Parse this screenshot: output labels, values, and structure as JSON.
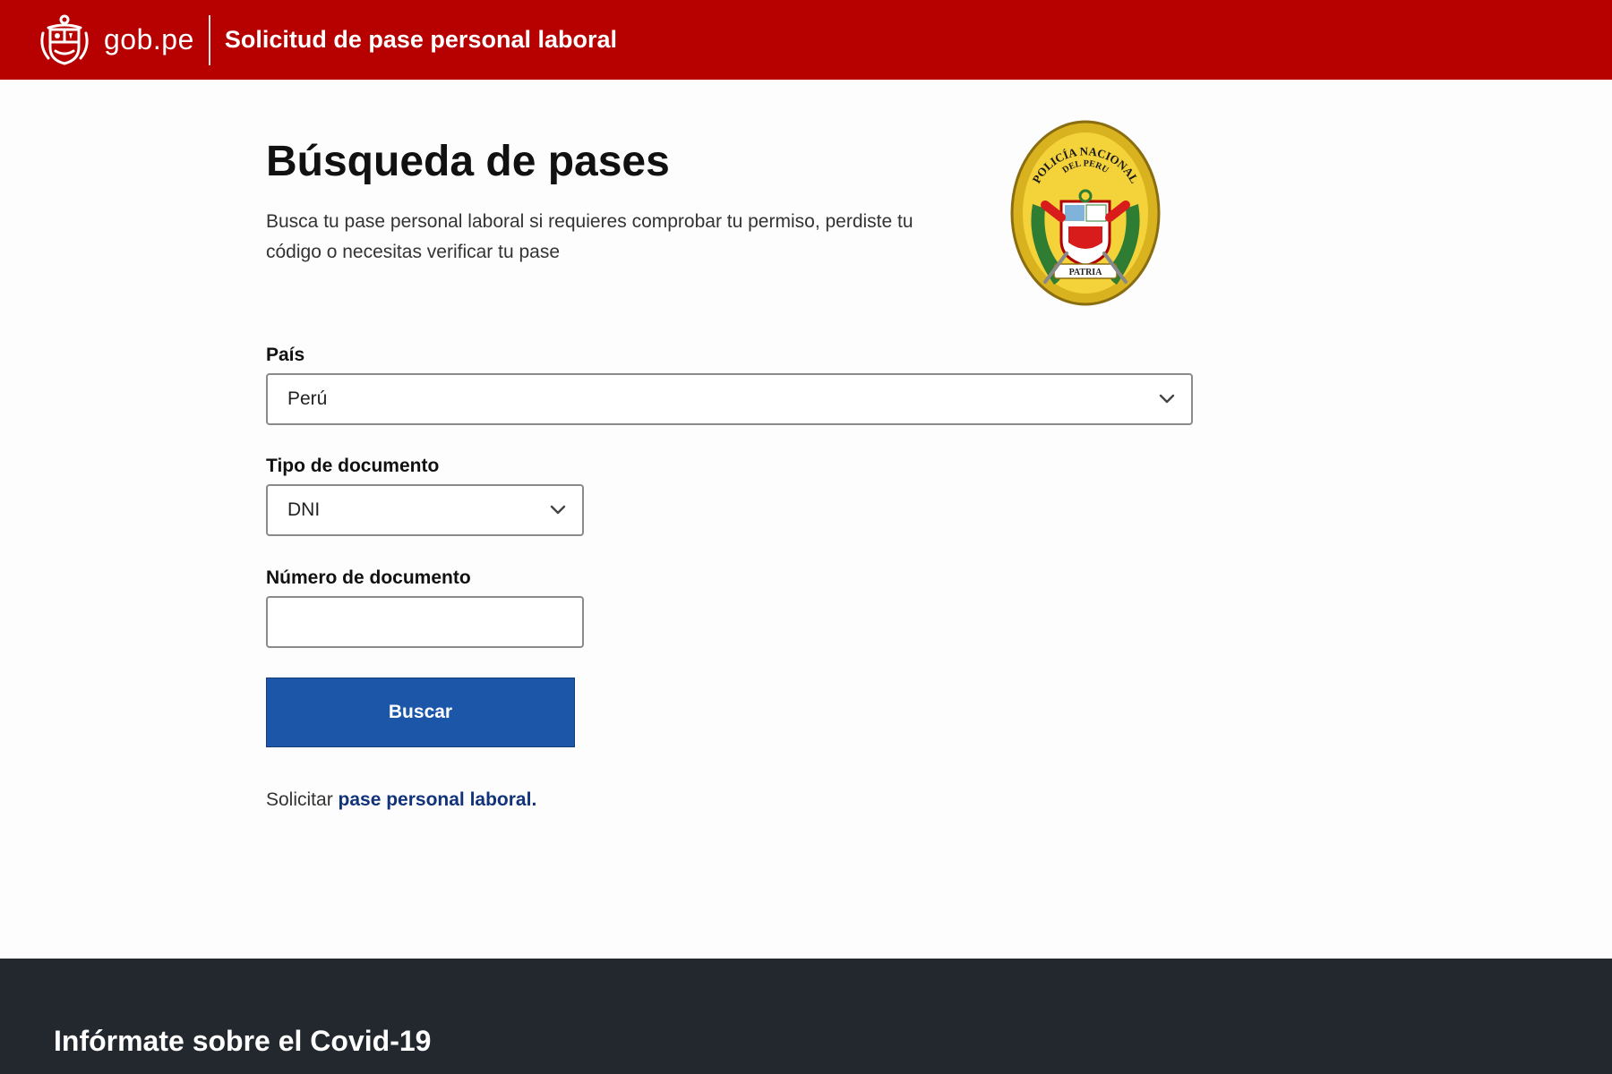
{
  "header": {
    "brand_text": "gob.pe",
    "title": "Solicitud de pase personal laboral",
    "brand_color": "#b70000"
  },
  "main": {
    "title": "Búsqueda de pases",
    "description": "Busca tu pase personal laboral si requieres comprobar tu permiso, perdiste tu código o necesitas verificar tu pase",
    "badge": {
      "text_top": "POLICÍA NACIONAL",
      "text_mid": "DEL PERU",
      "text_bottom": "PATRIA"
    },
    "country": {
      "label": "País",
      "value": "Perú"
    },
    "doc_type": {
      "label": "Tipo de documento",
      "value": "DNI"
    },
    "doc_number": {
      "label": "Número de documento",
      "value": ""
    },
    "search_button": "Buscar",
    "request_prefix": "Solicitar ",
    "request_link": "pase personal laboral."
  },
  "footer": {
    "title": "Infórmate sobre el Covid-19",
    "background": "#22282d"
  },
  "colors": {
    "primary_button": "#1c56a8",
    "link": "#11337a"
  },
  "icons": [
    "peru-coat-of-arms-icon",
    "police-badge-icon",
    "chevron-down-icon"
  ]
}
